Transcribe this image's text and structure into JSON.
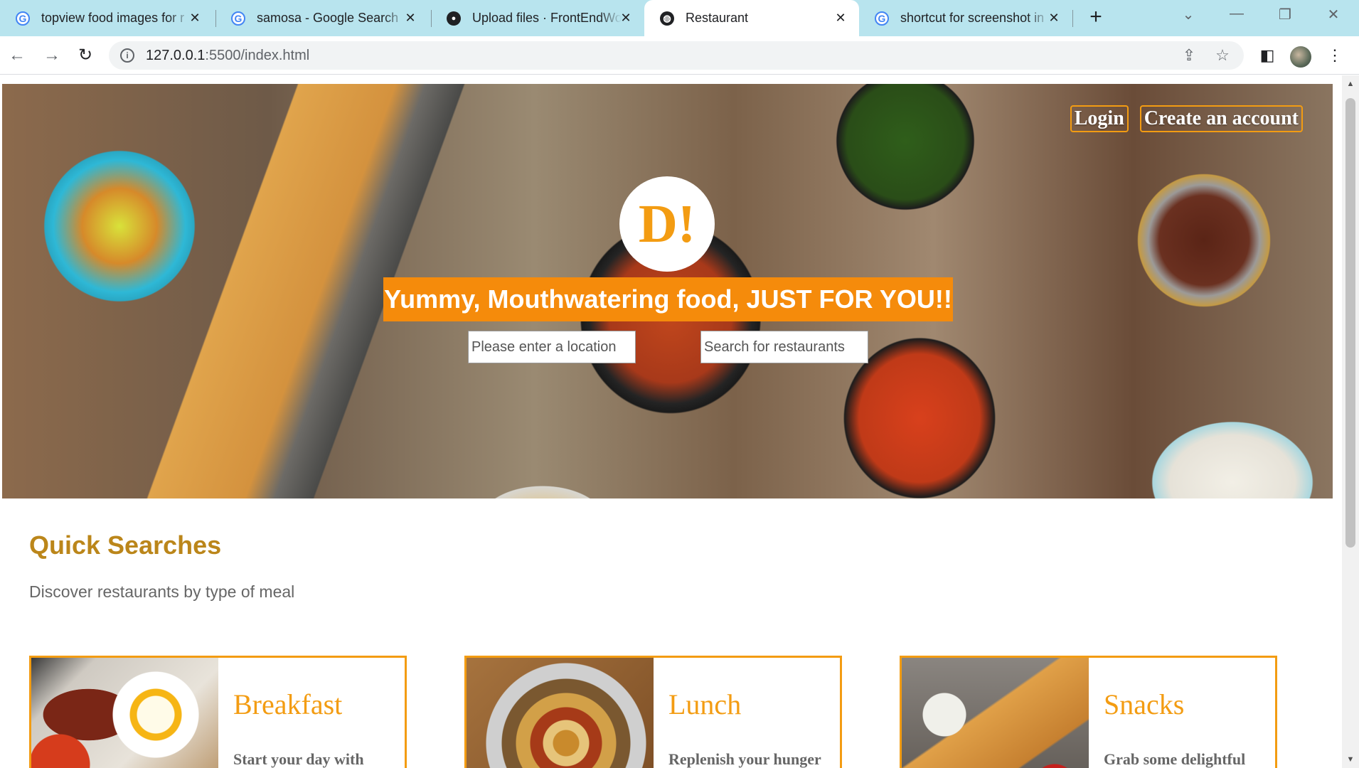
{
  "browser": {
    "tabs": [
      {
        "title": "topview food images for r",
        "icon": "google-icon",
        "active": false
      },
      {
        "title": "samosa - Google Search",
        "icon": "google-icon",
        "active": false
      },
      {
        "title": "Upload files · FrontEndWo",
        "icon": "github-icon",
        "active": false
      },
      {
        "title": "Restaurant",
        "icon": "globe-icon",
        "active": true
      },
      {
        "title": "shortcut for screenshot in",
        "icon": "google-icon",
        "active": false
      }
    ],
    "address": {
      "host": "127.0.0.1",
      "path": ":5500/index.html"
    }
  },
  "header": {
    "login_label": "Login",
    "signup_label": "Create an account",
    "logo_text": "D!",
    "tagline": "Yummy, Mouthwatering food, JUST FOR YOU!!",
    "location_placeholder": "Please enter a location",
    "search_placeholder": "Search for restaurants"
  },
  "quick_searches": {
    "title": "Quick Searches",
    "subtitle": "Discover restaurants by type of meal",
    "cards": [
      {
        "name": "Breakfast",
        "desc": "Start your day with"
      },
      {
        "name": "Lunch",
        "desc": "Replenish your hunger"
      },
      {
        "name": "Snacks",
        "desc": "Grab some delightful"
      }
    ]
  },
  "colors": {
    "accent": "#f39c12",
    "tagline_bg": "#f58b0b",
    "heading": "#bb861a",
    "tabstrip": "#b8e4ee"
  }
}
